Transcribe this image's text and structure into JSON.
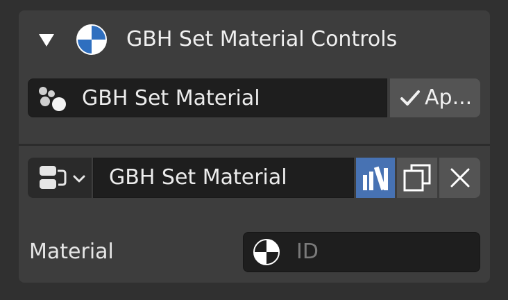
{
  "panel": {
    "title": "GBH Set Material Controls",
    "icons": {
      "collapse": "triangle-down-icon",
      "header": "material-sphere-icon"
    }
  },
  "node_selector": {
    "label": "GBH Set Material",
    "icon": "node-group-icon",
    "apply_label": "Ap...",
    "apply_icon": "checkmark-icon"
  },
  "datablock": {
    "name": "GBH Set Material",
    "browse_icon": "node-tree-browse-icon",
    "fake_user_icon": "fake-user-icon",
    "fake_user_active": true,
    "duplicate_icon": "duplicate-icon",
    "unlink_icon": "close-icon"
  },
  "material_field": {
    "label": "Material",
    "placeholder": "ID",
    "icon": "material-sphere-icon"
  },
  "colors": {
    "background": "#303030",
    "panel": "#3d3d3d",
    "field": "#1e1e1e",
    "button": "#545454",
    "accent": "#4772b3",
    "text": "#e6e6e6",
    "placeholder": "#7a7a7a"
  }
}
